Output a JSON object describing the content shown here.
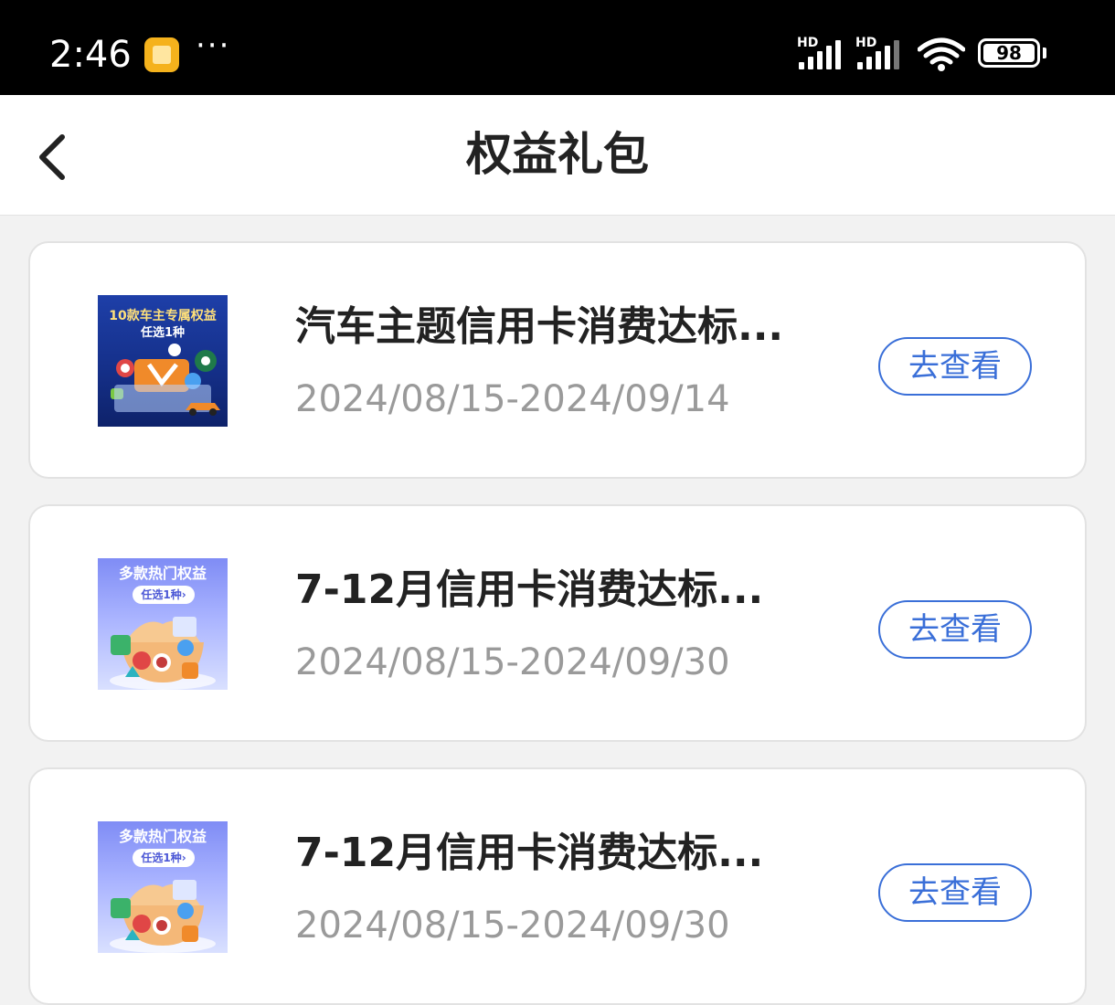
{
  "status_bar": {
    "time": "2:46",
    "more": "···",
    "signal_1_label": "HD",
    "signal_2_label": "HD",
    "battery": "98"
  },
  "header": {
    "title": "权益礼包",
    "back_icon": "chevron-left-icon"
  },
  "colors": {
    "accent": "#3a6fd8",
    "title_text": "#222222",
    "date_text": "#9a9a9a",
    "background": "#f2f2f2",
    "card_bg": "#ffffff"
  },
  "cards": [
    {
      "thumb_headline": "10款车主专属权益",
      "thumb_sub": "任选1种",
      "title": "汽车主题信用卡消费达标...",
      "date_range": "2024/08/15-2024/09/14",
      "button_label": "去查看"
    },
    {
      "thumb_headline": "多款热门权益",
      "thumb_sub": "任选1种›",
      "title": "7-12月信用卡消费达标...",
      "date_range": "2024/08/15-2024/09/30",
      "button_label": "去查看"
    },
    {
      "thumb_headline": "多款热门权益",
      "thumb_sub": "任选1种›",
      "title": "7-12月信用卡消费达标...",
      "date_range": "2024/08/15-2024/09/30",
      "button_label": "去查看"
    }
  ]
}
